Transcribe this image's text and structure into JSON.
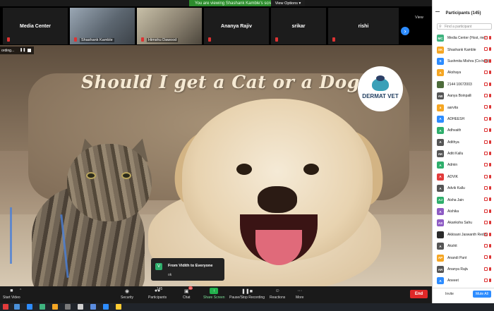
{
  "banner": {
    "text": "You are viewing Shashank Kamble's screen",
    "view_options": "View Options ▾"
  },
  "strip": {
    "tiles": [
      {
        "name": "Media Center"
      },
      {
        "name": "Shashank Kamble"
      },
      {
        "name": "Himshu Dawood"
      },
      {
        "name": "Ananya Rajiv"
      },
      {
        "name": "srikar"
      },
      {
        "name": "rishi"
      }
    ],
    "view_label": "View"
  },
  "share": {
    "title": "Should I get a Cat or a Dog?",
    "logo_text": "DERMAT VET",
    "recording_label": "ording..."
  },
  "chat_popup": {
    "avatar": "V",
    "from": "From Vidith to Everyone",
    "message": "ok"
  },
  "toolbar": {
    "start_video": "Start Video",
    "security": "Security",
    "participants": "Participants",
    "participants_count": "145",
    "chat": "Chat",
    "chat_badge": "20",
    "share_screen": "Share Screen",
    "recording": "Pause/Stop Recording",
    "reactions": "Reactions",
    "more": "More",
    "end": "End"
  },
  "panel": {
    "title": "Participants (145)",
    "search_placeholder": "Find a participant",
    "participants": [
      {
        "initials": "MC",
        "name": "Media Center (Host, me)",
        "color": "#3fb37f"
      },
      {
        "initials": "SK",
        "name": "Shashank Kamble",
        "color": "#f5a623"
      },
      {
        "initials": "S",
        "name": "Sushmita Mishra (Co-host)",
        "color": "#2d8cff"
      },
      {
        "initials": "A",
        "name": "Akshaya",
        "color": "#f5a623"
      },
      {
        "initials": "",
        "name": "2144 10672003",
        "color": "#4d6b3a"
      },
      {
        "initials": "AB",
        "name": "Aanya Boinpalli",
        "color": "#555555"
      },
      {
        "initials": "a",
        "name": "aarvita",
        "color": "#f5a623"
      },
      {
        "initials": "A",
        "name": "ADHEESH",
        "color": "#2d8cff"
      },
      {
        "initials": "A",
        "name": "Adhvaith",
        "color": "#2eae6b"
      },
      {
        "initials": "A",
        "name": "Adithya",
        "color": "#555555"
      },
      {
        "initials": "AK",
        "name": "Aditi Kallu",
        "color": "#555555"
      },
      {
        "initials": "A",
        "name": "Admin",
        "color": "#2eae6b"
      },
      {
        "initials": "A",
        "name": "ADVIK",
        "color": "#e23b3b"
      },
      {
        "initials": "A",
        "name": "Advik Kallu",
        "color": "#555555"
      },
      {
        "initials": "AJ",
        "name": "Aisha Jain",
        "color": "#2eae6b"
      },
      {
        "initials": "A",
        "name": "Aishika",
        "color": "#8e5bc4"
      },
      {
        "initials": "AS",
        "name": "Akanksha Sahu",
        "color": "#8e5bc4"
      },
      {
        "initials": "",
        "name": "Akkisani Jaswanth Reddy",
        "color": "#2a2a2a"
      },
      {
        "initials": "A",
        "name": "Akshit",
        "color": "#555555"
      },
      {
        "initials": "AP",
        "name": "Anandi Pant",
        "color": "#f5a623"
      },
      {
        "initials": "AR",
        "name": "Ananya Rajiv",
        "color": "#555555"
      },
      {
        "initials": "A",
        "name": "Aneeet",
        "color": "#2d8cff"
      }
    ],
    "invite": "Invite",
    "mute_all": "Mute All"
  },
  "colors": {
    "accent": "#2d8cff",
    "share_green": "#22b14c",
    "end_red": "#e02828"
  }
}
